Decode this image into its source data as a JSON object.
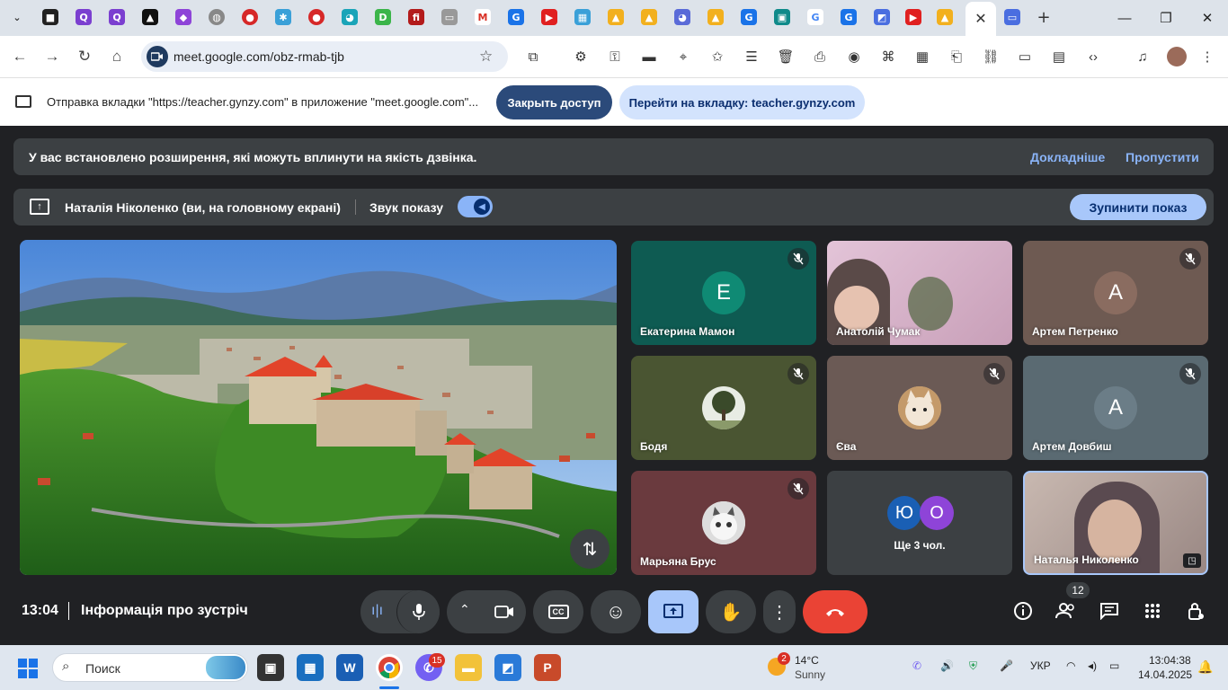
{
  "browser": {
    "url": "meet.google.com/obz-rmab-tjb",
    "close_tab": "✕",
    "new_tab": "+"
  },
  "infobar": {
    "text": "Отправка вкладки \"https://teacher.gynzy.com\" в приложение \"meet.google.com\"...",
    "close_access": "Закрыть доступ",
    "goto_tab": "Перейти на вкладку: teacher.gynzy.com"
  },
  "meet": {
    "banner_text": "У вас встановлено розширення, які можуть вплинути на якість дзвінка.",
    "banner_more": "Докладніше",
    "banner_skip": "Пропустити",
    "presenting_name": "Наталія Ніколенко (ви, на головному екрані)",
    "sound_label": "Звук показу",
    "stop_button": "Зупинити показ",
    "time": "13:04",
    "meeting_info": "Інформація про зустріч",
    "participants_count": "12",
    "tiles": [
      {
        "name": "Екатерина Мамон",
        "initial": "E",
        "bg": "#0e5b52",
        "avatar": "#0f7a6a",
        "muted": true
      },
      {
        "name": "Анатолій Чумак",
        "bg": "#c9a7bf",
        "muted": false
      },
      {
        "name": "Артем Петренко",
        "initial": "A",
        "bg": "#6e5a52",
        "avatar": "#8a6c60",
        "muted": true
      },
      {
        "name": "Бодя",
        "bg": "#4a5532",
        "muted": true
      },
      {
        "name": "Єва",
        "bg": "#6b5a55",
        "muted": true
      },
      {
        "name": "Артем Довбиш",
        "initial": "A",
        "bg": "#5a6a72",
        "avatar": "#6b7d87",
        "muted": true
      },
      {
        "name": "Марьяна Брус",
        "bg": "#6a3a3e",
        "muted": true
      },
      {
        "name": "Ще 3 чол.",
        "bg": "#3c4043",
        "initials": [
          "Ю",
          "О"
        ]
      },
      {
        "name": "Наталья Николенко",
        "bg": "#a89590"
      }
    ]
  },
  "taskbar": {
    "search_placeholder": "Поиск",
    "weather_temp": "14°C",
    "weather_desc": "Sunny",
    "weather_badge": "2",
    "viber_badge": "15",
    "lang": "УКР",
    "time": "13:04:38",
    "date": "14.04.2025"
  },
  "colors": {
    "end_call": "#ea4335",
    "present_active": "#a8c7fa",
    "accent_link": "#8ab4f8"
  }
}
